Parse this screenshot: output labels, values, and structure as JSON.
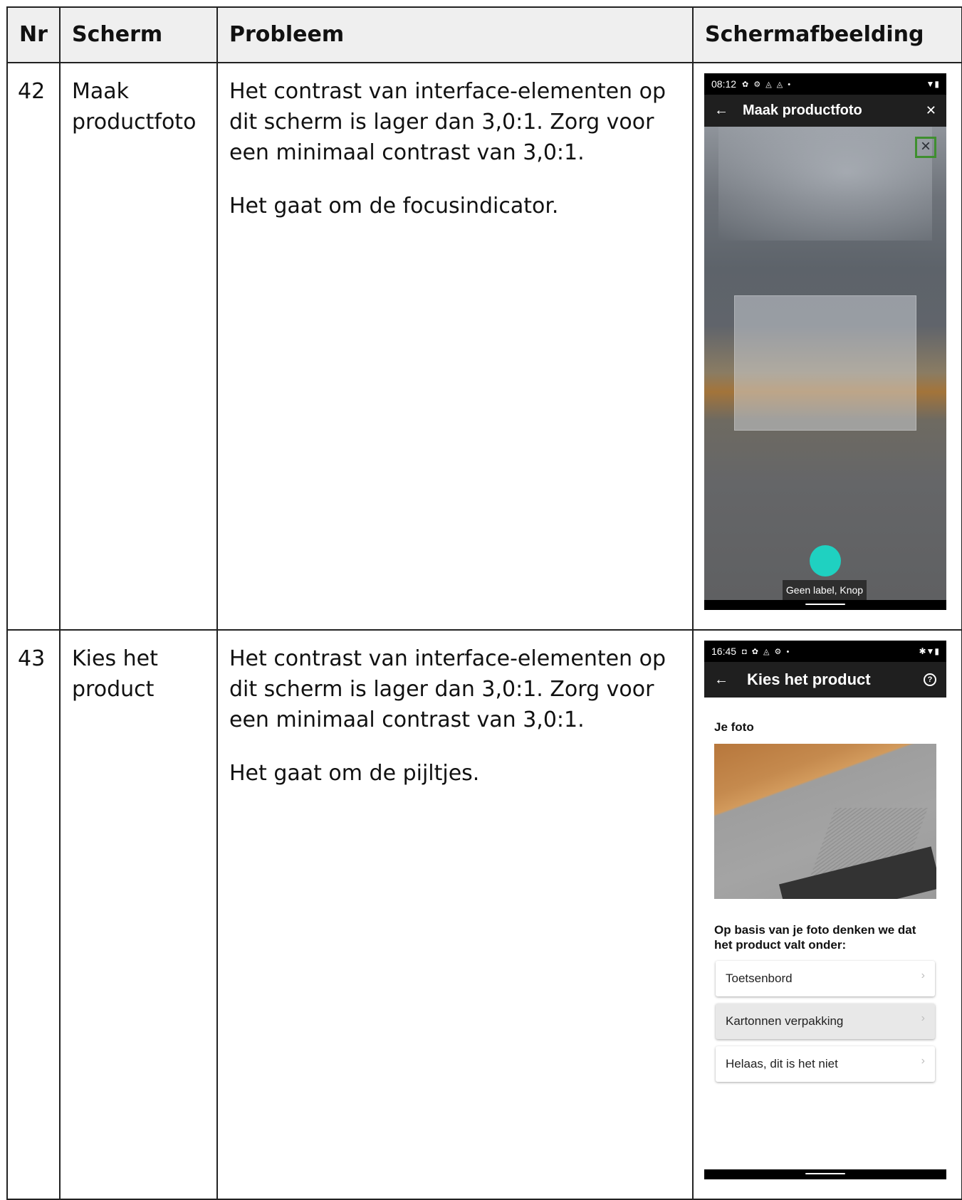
{
  "table": {
    "headers": {
      "nr": "Nr",
      "scherm": "Scherm",
      "probleem": "Probleem",
      "schermafbeelding": "Schermafbeelding"
    },
    "rows": [
      {
        "nr": "42",
        "scherm": "Maak productfoto",
        "probleem": [
          "Het contrast van interface-elementen op dit scherm is lager dan 3,0:1. Zorg voor een minimaal contrast van 3,0:1.",
          "Het gaat om de focusindicator."
        ],
        "screenshot": {
          "status_time": "08:12",
          "appbar_title": "Maak productfoto",
          "back_icon": "arrow-left-icon",
          "close_icon": "close-icon",
          "focus_indicator_color": "#3f8f2f",
          "shutter_color": "#1fd1c1",
          "tooltip": "Geen label, Knop"
        }
      },
      {
        "nr": "43",
        "scherm": "Kies het product",
        "probleem": [
          "Het contrast van interface-elementen op dit scherm is lager dan 3,0:1. Zorg voor een minimaal contrast van 3,0:1.",
          "Het gaat om de pijltjes."
        ],
        "screenshot": {
          "status_time": "16:45",
          "appbar_title": "Kies het product",
          "help_icon": "help-circle-icon",
          "section_label": "Je foto",
          "question": "Op basis van je foto denken we dat het product valt onder:",
          "options": [
            "Toetsenbord",
            "Kartonnen verpakking",
            "Helaas, dit is het niet"
          ],
          "chevron_icon": "chevron-right-icon"
        }
      }
    ]
  }
}
